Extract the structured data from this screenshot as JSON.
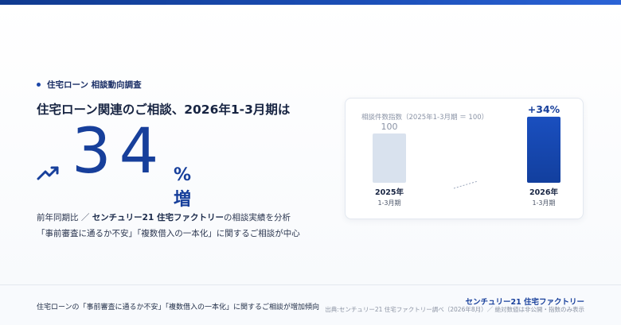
{
  "section_tag": "住宅ローン 相談動向調査",
  "headline": "住宅ローン関連のご相談、2026年1-3月期は",
  "big_number": "34",
  "big_suffix": "%増",
  "description": {
    "line1_prefix": "前年同期比 ／ ",
    "line1_brand": "センチュリー21 住宅ファクトリー",
    "line1_suffix": "の相談実績を分析",
    "line2": "「事前審査に通るか不安」「複数借入の一本化」に関するご相談が中心"
  },
  "chart_data": {
    "type": "bar",
    "title": "相談件数指数（2025年1-3月期 ＝ 100）",
    "categories": [
      {
        "year": "2025年",
        "period": "1-3月期"
      },
      {
        "year": "2026年",
        "period": "1-3月期"
      }
    ],
    "values": [
      100,
      134
    ],
    "data_labels": [
      "100",
      "+34%"
    ],
    "bar_colors": [
      "#d9e2ee",
      "#123f9e"
    ],
    "grid": false
  },
  "footer": {
    "summary": "住宅ローンの「事前審査に通るか不安」「複数借入の一本化」に関するご相談が増加傾向",
    "brand": "センチュリー21 住宅ファクトリー",
    "source": "出典:センチュリー21 住宅ファクトリー調べ（2026年8月）／ 絶対数値は非公開・指数のみ表示"
  },
  "colors": {
    "accent": "#173f9b",
    "top_bar": "#1c4fb8"
  }
}
